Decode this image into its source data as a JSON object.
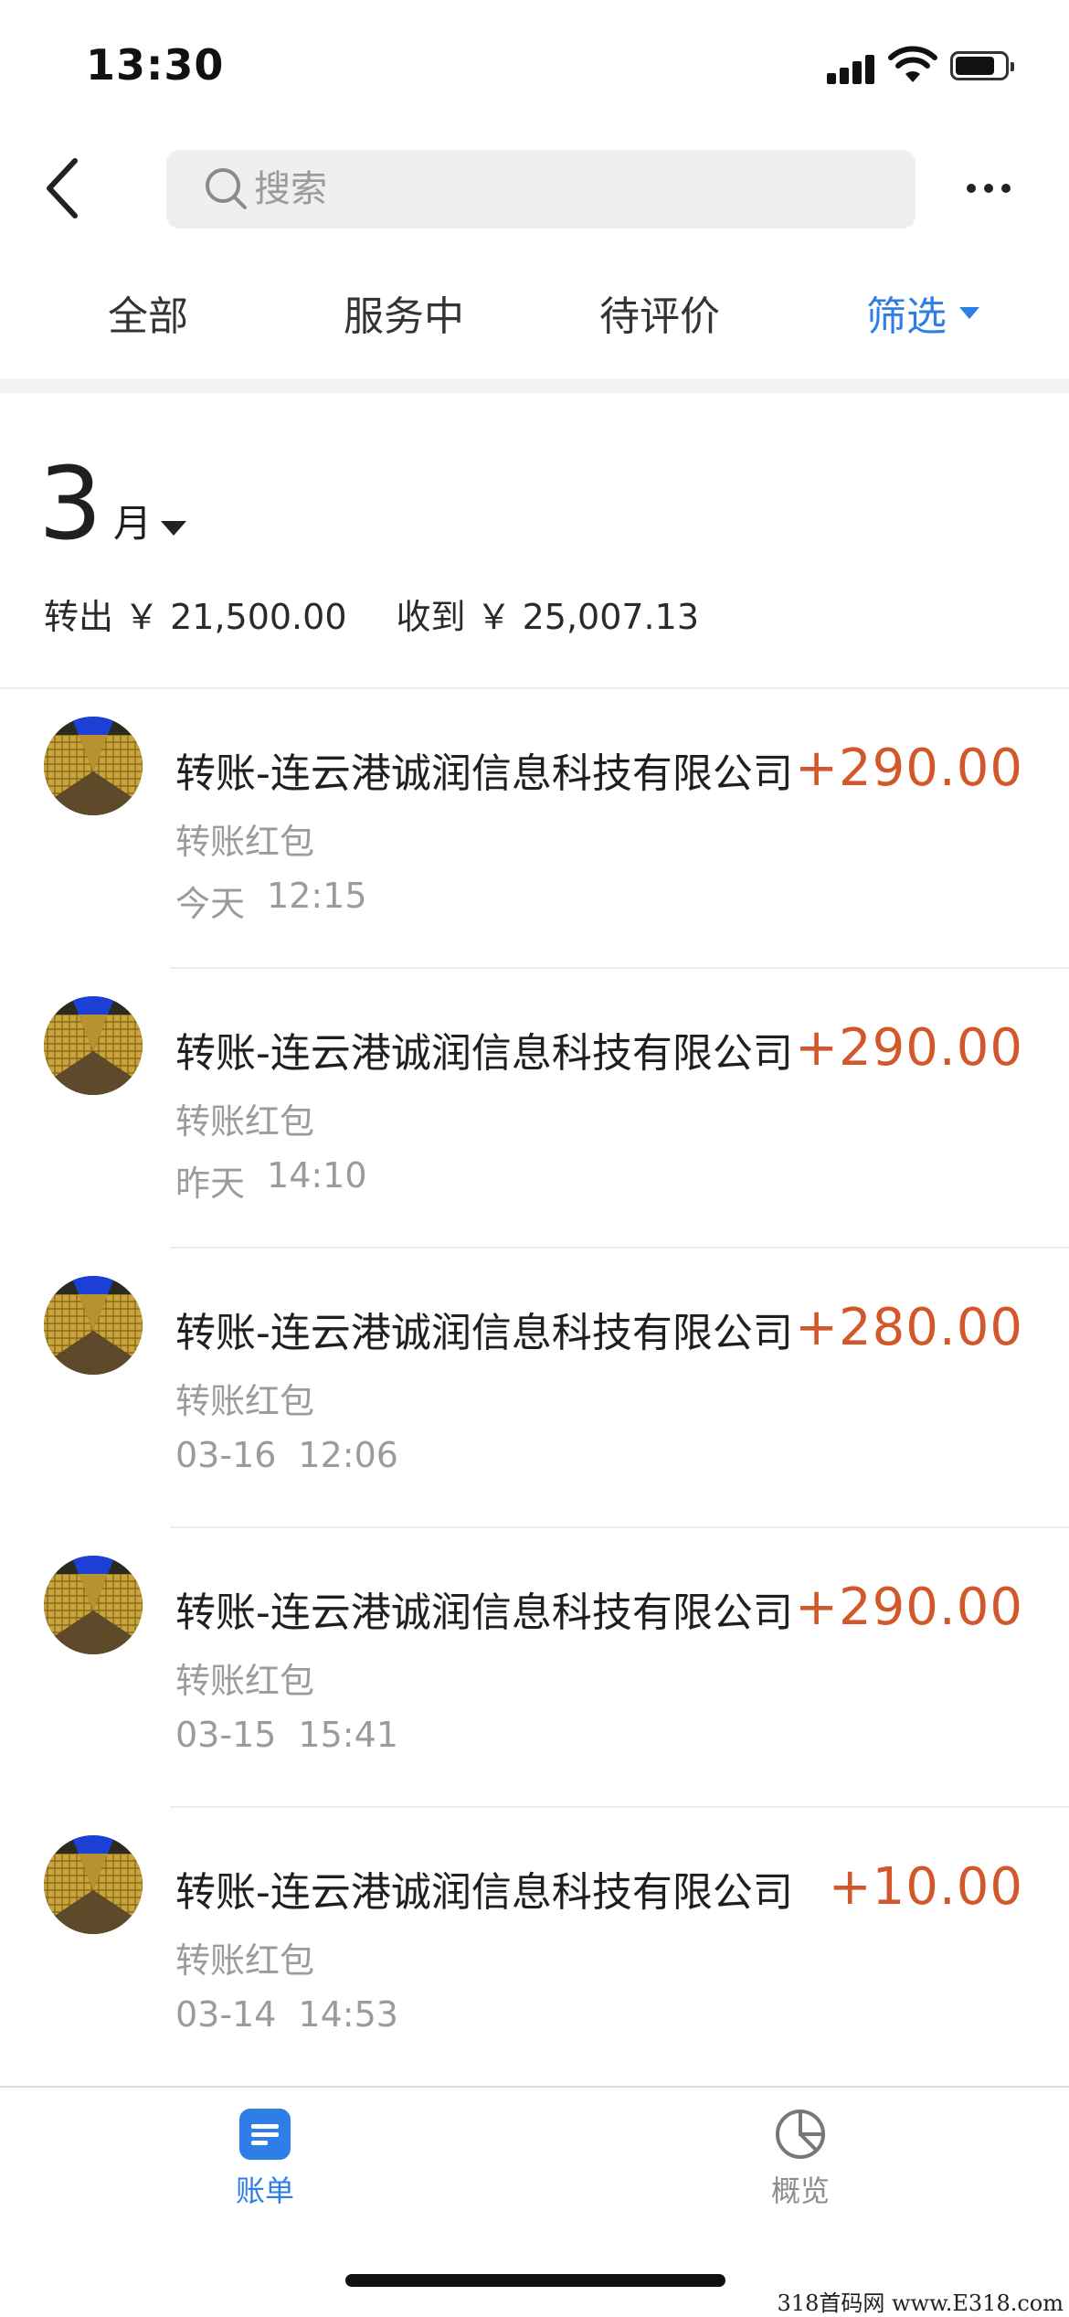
{
  "status_bar": {
    "time": "13:30"
  },
  "header": {
    "search_placeholder": "搜索"
  },
  "tabs": [
    {
      "label": "全部"
    },
    {
      "label": "服务中"
    },
    {
      "label": "待评价"
    },
    {
      "label": "筛选"
    }
  ],
  "summary": {
    "month": "3",
    "month_unit": "月",
    "out_label": "转出",
    "out_amount": "￥ 21,500.00",
    "in_label": "收到",
    "in_amount": "￥ 25,007.13"
  },
  "transactions": [
    {
      "title": "转账-连云港诚润信息科技有限公司",
      "amount": "+290.00",
      "subtitle": "转账红包",
      "date": "今天",
      "time": "12:15"
    },
    {
      "title": "转账-连云港诚润信息科技有限公司",
      "amount": "+290.00",
      "subtitle": "转账红包",
      "date": "昨天",
      "time": "14:10"
    },
    {
      "title": "转账-连云港诚润信息科技有限公司",
      "amount": "+280.00",
      "subtitle": "转账红包",
      "date": "03-16",
      "time": "12:06"
    },
    {
      "title": "转账-连云港诚润信息科技有限公司",
      "amount": "+290.00",
      "subtitle": "转账红包",
      "date": "03-15",
      "time": "15:41"
    },
    {
      "title": "转账-连云港诚润信息科技有限公司",
      "amount": "+10.00",
      "subtitle": "转账红包",
      "date": "03-14",
      "time": "14:53"
    }
  ],
  "bottom_nav": [
    {
      "label": "账单",
      "icon": "bill-icon"
    },
    {
      "label": "概览",
      "icon": "pie-chart-icon"
    }
  ],
  "colors": {
    "accent": "#2f7ee8",
    "amount": "#d2572a",
    "muted": "#9b9b9b"
  },
  "watermark": "318首码网 www.E318.com"
}
